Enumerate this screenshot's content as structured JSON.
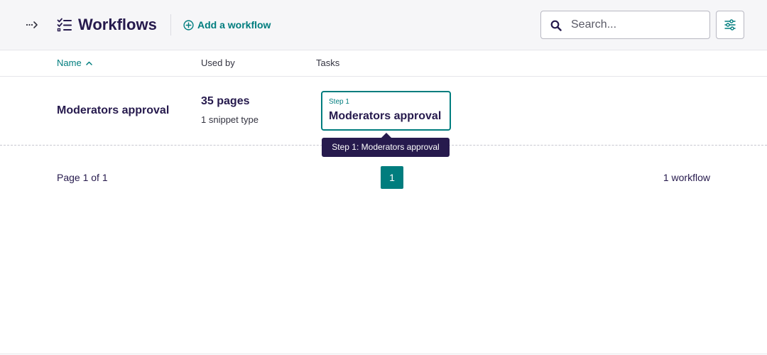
{
  "header": {
    "title": "Workflows",
    "add_label": "Add a workflow",
    "search_placeholder": "Search...",
    "icons": {
      "expand": "dotted-arrow-right-icon",
      "title": "task-list-icon",
      "add": "plus-circle-icon",
      "search": "search-icon",
      "filter": "sliders-icon"
    }
  },
  "table": {
    "columns": {
      "name": "Name",
      "used_by": "Used by",
      "tasks": "Tasks"
    },
    "sort": {
      "column": "name",
      "direction": "ascending"
    },
    "rows": [
      {
        "name": "Moderators approval",
        "pages": "35 pages",
        "snippet_types": "1 snippet type",
        "tasks": [
          {
            "step": "Step 1",
            "name": "Moderators approval",
            "tooltip": "Step 1: Moderators approval"
          }
        ]
      }
    ]
  },
  "pagination": {
    "page_info": "Page 1 of 1",
    "current_page": "1",
    "total": "1 workflow"
  },
  "colors": {
    "accent": "#007d7e",
    "primary_text": "#261a4d",
    "tooltip_bg": "#261a4d",
    "header_bg": "#f6f6f8"
  }
}
